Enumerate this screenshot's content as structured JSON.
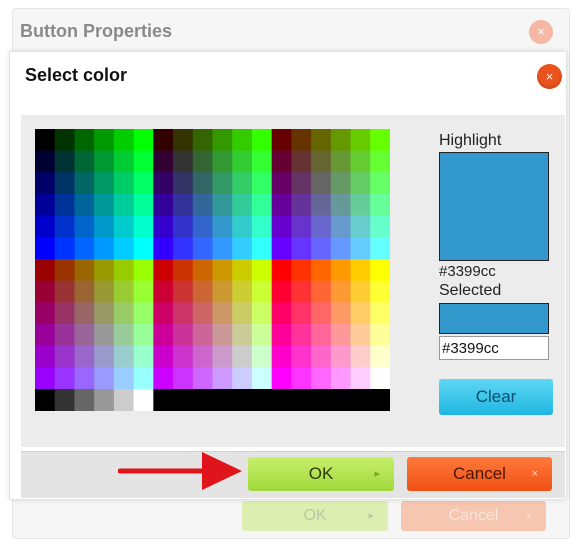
{
  "background_dialog": {
    "title": "Button Properties",
    "close_glyph": "×",
    "ok_label": "OK",
    "ok_glyph": "▸",
    "cancel_label": "Cancel",
    "cancel_glyph": "×"
  },
  "dialog": {
    "title": "Select color",
    "close_glyph": "×",
    "highlight_label": "Highlight",
    "highlight_value": "#3399cc",
    "selected_label": "Selected",
    "selected_value": "#3399cc",
    "clear_label": "Clear",
    "ok_label": "OK",
    "ok_glyph": "▸",
    "cancel_label": "Cancel",
    "cancel_glyph": "×"
  },
  "colors": {
    "highlight": "#3399cc",
    "selected": "#3399cc",
    "ok_button": "#a8dc3f",
    "cancel_button": "#f25a1c",
    "close_button": "#e9531d",
    "annotation_arrow": "#e0141b"
  },
  "icons": {
    "close": "close-icon",
    "ok_chevron": "chevron-right-icon",
    "cancel_x": "x-icon",
    "annotation": "red-arrow-icon"
  }
}
